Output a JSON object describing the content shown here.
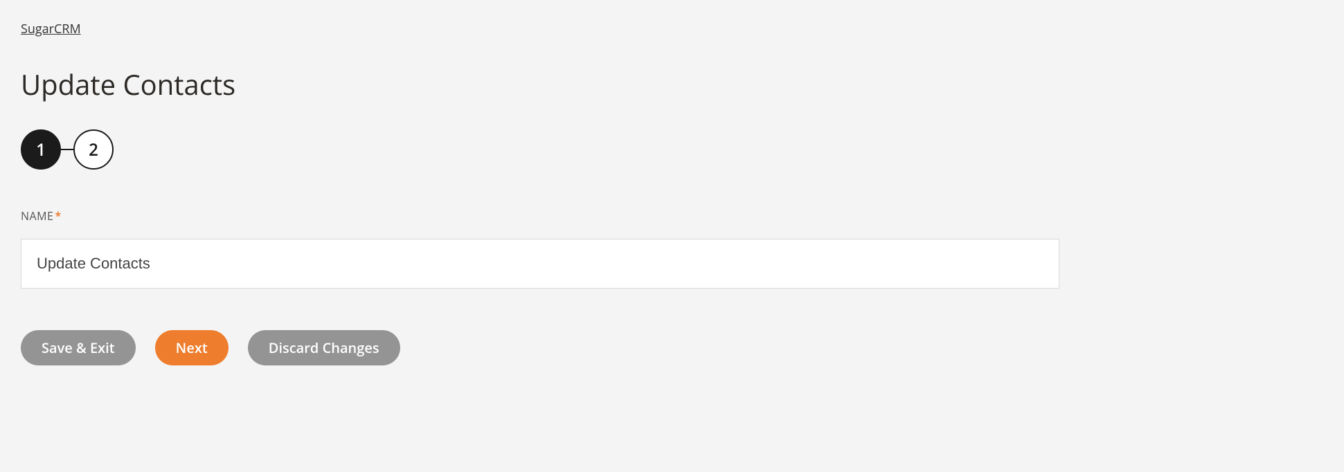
{
  "breadcrumb": {
    "label": "SugarCRM"
  },
  "page": {
    "title": "Update Contacts"
  },
  "stepper": {
    "steps": [
      {
        "label": "1",
        "active": true
      },
      {
        "label": "2",
        "active": false
      }
    ]
  },
  "form": {
    "name_label": "NAME",
    "required_mark": "*",
    "name_value": "Update Contacts"
  },
  "actions": {
    "save_exit": "Save & Exit",
    "next": "Next",
    "discard": "Discard Changes"
  }
}
